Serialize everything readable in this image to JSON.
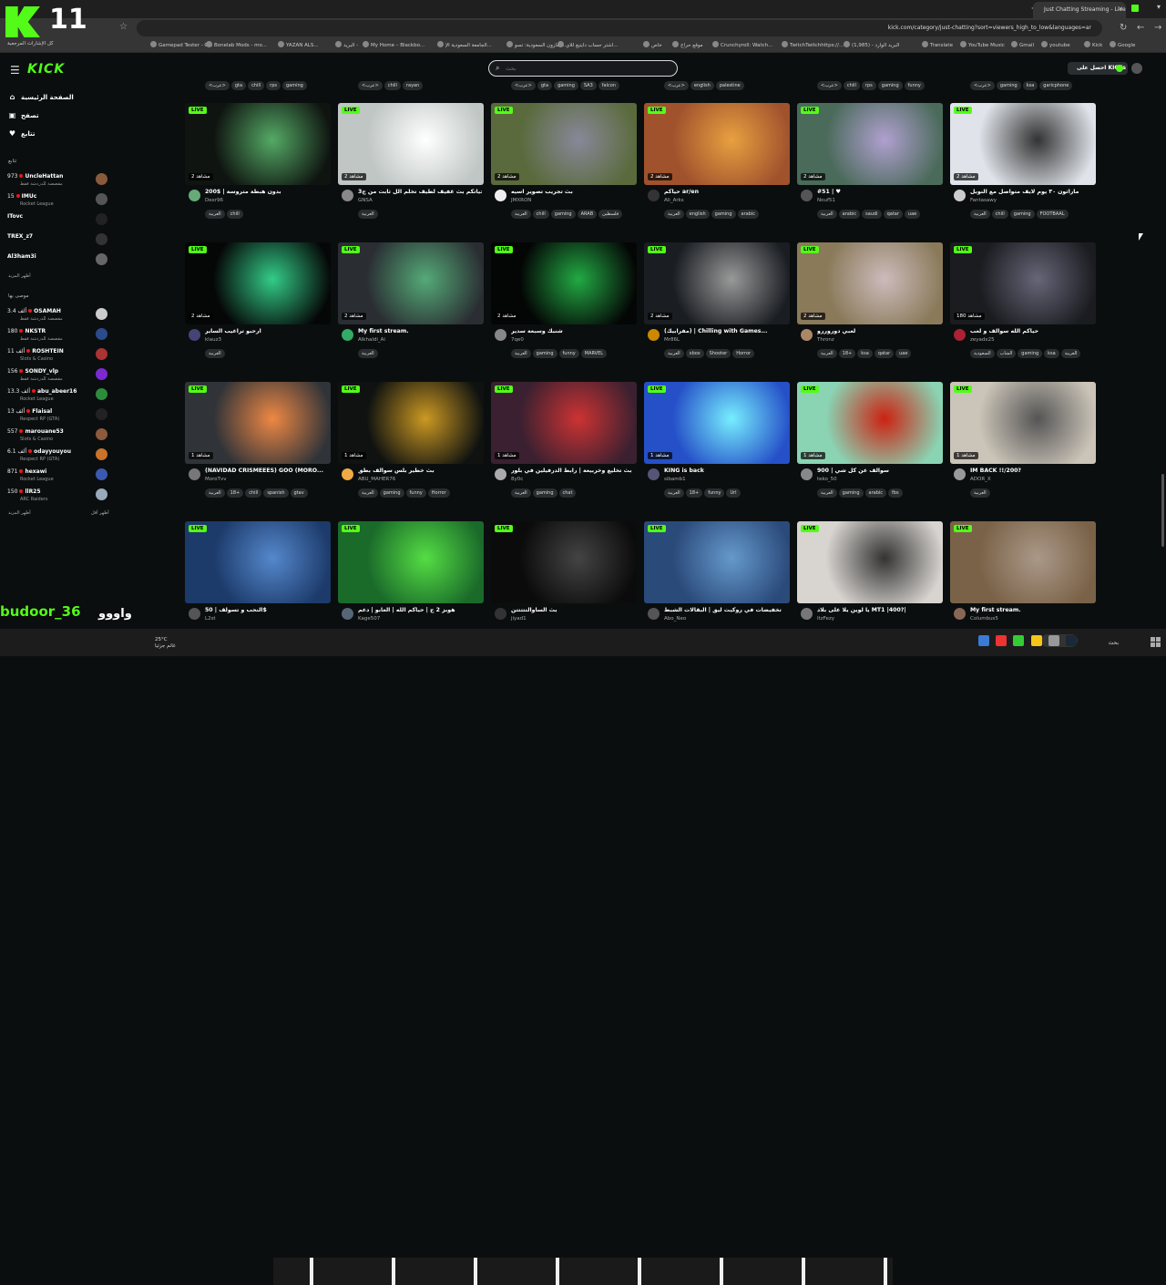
{
  "overlay": {
    "counter": "11",
    "chat_user": "budoor_36",
    "chat_text": "واووو"
  },
  "browser": {
    "tab_title": "Just Chatting Streaming - Live",
    "url": "kick.com/category/just-chatting?sort=viewers_high_to_low&languages=ar",
    "bookmarks": [
      "Gamepad Tester - C...",
      "Bonelab Mods - mo...",
      "YAZAN ALS...",
      "البريد -",
      "My Home – Blackbo...",
      "الجامعة السعودية الإ...",
      "أمازون السعودية: تسو...",
      "اشتر حساب دايتيغ للاي...",
      "خاص",
      "موقع حراج",
      "Crunchyroll: Watch...",
      "TwitchTwitchhttps://...",
      "البريد الوارد - (1,985)",
      "Translate",
      "YouTube Music",
      "Gmail",
      "youtube",
      "Kick",
      "Google"
    ],
    "all_bookmarks": "كل الإشارات المرجعية"
  },
  "header": {
    "search_placeholder": "بحث",
    "cta": "احصل على KICKs",
    "logo": "KICK"
  },
  "sidebar": {
    "nav": [
      {
        "icon": "home-icon",
        "label": "الصفحة الرئيسية"
      },
      {
        "icon": "browse-icon",
        "label": "تصفح"
      },
      {
        "icon": "heart-icon",
        "label": "تتابع"
      }
    ],
    "following_header": "تتابع",
    "recommended_header": "موصى بها",
    "show_more": "أظهر المزيد",
    "show_less": "أظهر أقل",
    "following": [
      {
        "viewers": "973",
        "name": "UncleHattan",
        "cat": "مقصصة للدردشة فقط",
        "color": "#8a5a3c",
        "live": true
      },
      {
        "viewers": "15",
        "name": "IMUc",
        "cat": "Rocket League",
        "color": "#555",
        "live": true
      },
      {
        "viewers": "",
        "name": "ITovc",
        "cat": "",
        "color": "#222",
        "live": false
      },
      {
        "viewers": "",
        "name": "TREX_z7",
        "cat": "",
        "color": "#333",
        "live": false
      },
      {
        "viewers": "",
        "name": "Al3ham3i",
        "cat": "",
        "color": "#666",
        "live": false
      }
    ],
    "recommended": [
      {
        "viewers": "3.4 ألف",
        "name": "OSAMAH",
        "cat": "مقصصة للدردشة فقط",
        "color": "#ccc"
      },
      {
        "viewers": "180",
        "name": "NKSTR",
        "cat": "مقصصة للدردشة فقط",
        "color": "#2a4b8c"
      },
      {
        "viewers": "11 ألف",
        "name": "ROSHTEIN",
        "cat": "Slots & Casino",
        "color": "#a33"
      },
      {
        "viewers": "156",
        "name": "SONDY_vlp",
        "cat": "مقصصة للدردشة فقط",
        "color": "#7a2ad0"
      },
      {
        "viewers": "13.3 ألف",
        "name": "abu_abeer16",
        "cat": "Rocket League",
        "color": "#2c8c3c"
      },
      {
        "viewers": "13 ألف",
        "name": "Flaisal",
        "cat": "Respect RP (GTA)",
        "color": "#222"
      },
      {
        "viewers": "557",
        "name": "marouane53",
        "cat": "Slots & Casino",
        "color": "#8c5a3c"
      },
      {
        "viewers": "6.1 ألف",
        "name": "odayyouyou",
        "cat": "Respect RP (GTA)",
        "color": "#c8722a"
      },
      {
        "viewers": "871",
        "name": "hexawi",
        "cat": "Rocket League",
        "color": "#3a5ab0"
      },
      {
        "viewers": "150",
        "name": "llR25",
        "cat": "ARC Raiders",
        "color": "#9ab"
      }
    ]
  },
  "top_tag_rows": [
    [
      "<عرب>",
      "gta",
      "chill",
      "rps",
      "gaming"
    ],
    [
      "<عرب>",
      "chill",
      "rayan"
    ],
    [
      "<عرب>",
      "gta",
      "gaming",
      "SA3",
      "falcon"
    ],
    [
      "<عرب>",
      "english",
      "palestine"
    ],
    [
      "<عرب>",
      "chill",
      "rps",
      "gaming",
      "funny"
    ],
    [
      "<عرب>",
      "gaming",
      "ksa",
      "garicphone"
    ]
  ],
  "streams": [
    {
      "title": "بدون هبطة متروسة | $200",
      "name": "Dexr96",
      "viewers": "2 مشاهد",
      "tags": [
        "العربية",
        "chill"
      ],
      "bg": "#0f1410",
      "accent": "#5a6",
      "avc": "#6a7"
    },
    {
      "title": "حياتكم بث غفيف لطيف تخلم الل ثابت من ج3",
      "name": "GNSA",
      "viewers": "2 مشاهد",
      "tags": [
        "العربية"
      ],
      "bg": "#bfc6c4",
      "accent": "#fff",
      "avc": "#888"
    },
    {
      "title": "بث تجريب تصوير اسيه",
      "name": "JMXRON",
      "viewers": "2 مشاهد",
      "tags": [
        "العربية",
        "chill",
        "gaming",
        "ARAB",
        "فلسطين"
      ],
      "bg": "#5a6a3c",
      "accent": "#889",
      "avc": "#eee"
    },
    {
      "title": "حياكم ar/en",
      "name": "Ali_Arks",
      "viewers": "2 مشاهد",
      "tags": [
        "العربية",
        "english",
        "gaming",
        "arabic"
      ],
      "bg": "#a0522d",
      "accent": "#e8a040",
      "avc": "#333"
    },
    {
      "title": "#51 | ♥",
      "name": "Nouf51",
      "viewers": "2 مشاهد",
      "tags": [
        "العربية",
        "arabic",
        "saudi",
        "qatar",
        "uae"
      ],
      "bg": "#4a6a5a",
      "accent": "#b0a0d0",
      "avc": "#555"
    },
    {
      "title": "ماراثون ٣٠ يوم لايف متواصل مع النوبل",
      "name": "Fantasawy",
      "viewers": "2 مشاهد",
      "tags": [
        "العربية",
        "chill",
        "gaming",
        "FOOTBAAL"
      ],
      "bg": "#e0e4ea",
      "accent": "#333",
      "avc": "#ccc"
    },
    {
      "title": "ارحبو تراعيب الساير",
      "name": "klauz3",
      "viewers": "2 مشاهد",
      "tags": [
        "العربية"
      ],
      "bg": "#050707",
      "accent": "#3c8",
      "avc": "#447"
    },
    {
      "title": "My first stream.",
      "name": "Alkhaldi_Ai",
      "viewers": "2 مشاهد",
      "tags": [
        "العربية"
      ],
      "bg": "#2a2e33",
      "accent": "#5a7",
      "avc": "#3a6"
    },
    {
      "title": "شنبك وسبعة سدير",
      "name": "7qe0",
      "viewers": "2 مشاهد",
      "tags": [
        "العربية",
        "gaming",
        "funny",
        "MARVEL"
      ],
      "bg": "#040505",
      "accent": "#2a4",
      "avc": "#888"
    },
    {
      "title": "(مفرابيك) | Chilling with Games...",
      "name": "Mr86L",
      "viewers": "2 مشاهد",
      "tags": [
        "العربية",
        "xbox",
        "Shooter",
        "Horror"
      ],
      "bg": "#1a1d22",
      "accent": "#999",
      "avc": "#c80"
    },
    {
      "title": "لعبي دوروررو",
      "name": "Thronz",
      "viewers": "2 مشاهد",
      "tags": [
        "العربية",
        "18+",
        "ksa",
        "qatar",
        "uae"
      ],
      "bg": "#8a7a5a",
      "accent": "#cbb",
      "avc": "#a86"
    },
    {
      "title": "حياكم الله سوالف و لعب",
      "name": "zeyadx25",
      "viewers": "180 مشاهد",
      "tags": [
        "السعودية",
        "الشاب",
        "gaming",
        "ksa",
        "العربية"
      ],
      "bg": "#1a1c20",
      "accent": "#667",
      "avc": "#a23"
    },
    {
      "title": "(NAVIDAD CRISMEEES) GOO (MORO...",
      "name": "MoroTvv",
      "viewers": "1 مشاهد",
      "tags": [
        "العربية",
        "18+",
        "chill",
        "spanish",
        "gtav"
      ],
      "bg": "#303338",
      "accent": "#e84",
      "avc": "#777"
    },
    {
      "title": "بث خطير بلس سوالف بطق",
      "name": "ABU_MAHER76",
      "viewers": "1 مشاهد",
      "tags": [
        "العربية",
        "gaming",
        "funny",
        "Horror"
      ],
      "bg": "#0f1210",
      "accent": "#c92",
      "avc": "#ea4"
    },
    {
      "title": "بث تخليع وخربيعة | رابط الدرفيلين في بلور",
      "name": "8y0c",
      "viewers": "1 مشاهد",
      "tags": [
        "العربية",
        "gaming",
        "chat"
      ],
      "bg": "#3a2030",
      "accent": "#c33",
      "avc": "#aaa"
    },
    {
      "title": "KING is back",
      "name": "sibamb1",
      "viewers": "1 مشاهد",
      "tags": [
        "العربية",
        "18+",
        "funny",
        "Url"
      ],
      "bg": "#2550c8",
      "accent": "#7ef",
      "avc": "#557"
    },
    {
      "title": "سوالف عن كل شي | 900",
      "name": "teko_50",
      "viewers": "1 مشاهد",
      "tags": [
        "العربية",
        "gaming",
        "arabic",
        "fbs"
      ],
      "bg": "#8ad4b4",
      "accent": "#c21",
      "avc": "#888"
    },
    {
      "title": "IM BACK !!/200?",
      "name": "ADOR_X",
      "viewers": "1 مشاهد",
      "tags": [
        "العربية"
      ],
      "bg": "#cbc4b8",
      "accent": "#555",
      "avc": "#999"
    },
    {
      "title": "النحب و تسولف | 50$",
      "name": "L2st",
      "viewers": "",
      "tags": [],
      "bg": "#1c3a6a",
      "accent": "#58c",
      "avc": "#555"
    },
    {
      "title": "هوبز 2 ج | حياكم الله | العابو | دعم",
      "name": "Kage507",
      "viewers": "",
      "tags": [],
      "bg": "#1a6a2a",
      "accent": "#5d4",
      "avc": "#567"
    },
    {
      "title": "بث الساوالتتتتتن",
      "name": "jiyad1",
      "viewers": "",
      "tags": [],
      "bg": "#0b0b0b",
      "accent": "#444",
      "avc": "#333"
    },
    {
      "title": "تخفيضات في روكيت ليق | البقالات الشبط",
      "name": "Abo_Neo",
      "viewers": "",
      "tags": [],
      "bg": "#2a4a7a",
      "accent": "#69c",
      "avc": "#555"
    },
    {
      "title": "يا لوين يلا على بلاد MT1 |400?|",
      "name": "ItzFezy",
      "viewers": "",
      "tags": [],
      "bg": "#d8d4d0",
      "accent": "#333",
      "avc": "#777"
    },
    {
      "title": "My first stream.",
      "name": "Columbus5",
      "viewers": "",
      "tags": [],
      "bg": "#7a6248",
      "accent": "#a98",
      "avc": "#865"
    }
  ],
  "taskbar": {
    "temp": "25°C",
    "weather": "غائم جزئيا",
    "search": "بحث"
  }
}
